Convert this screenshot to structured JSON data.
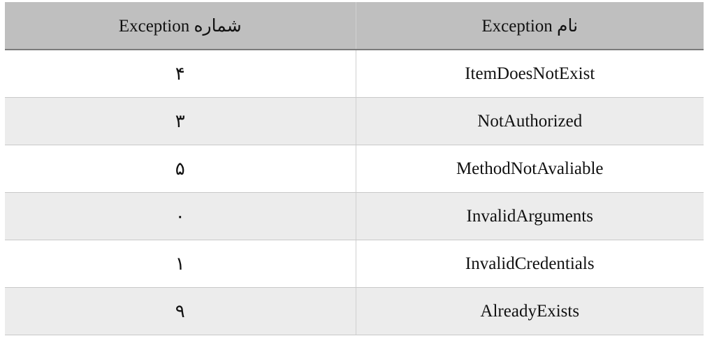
{
  "table": {
    "headers": {
      "name": "نام Exception",
      "number": "شماره Exception"
    },
    "rows": [
      {
        "name": "ItemDoesNotExist",
        "number": "۴"
      },
      {
        "name": "NotAuthorized",
        "number": "۳"
      },
      {
        "name": "MethodNotAvaliable",
        "number": "۵"
      },
      {
        "name": "InvalidArguments",
        "number": "۰"
      },
      {
        "name": "InvalidCredentials",
        "number": "۱"
      },
      {
        "name": "AlreadyExists",
        "number": "۹"
      }
    ]
  }
}
